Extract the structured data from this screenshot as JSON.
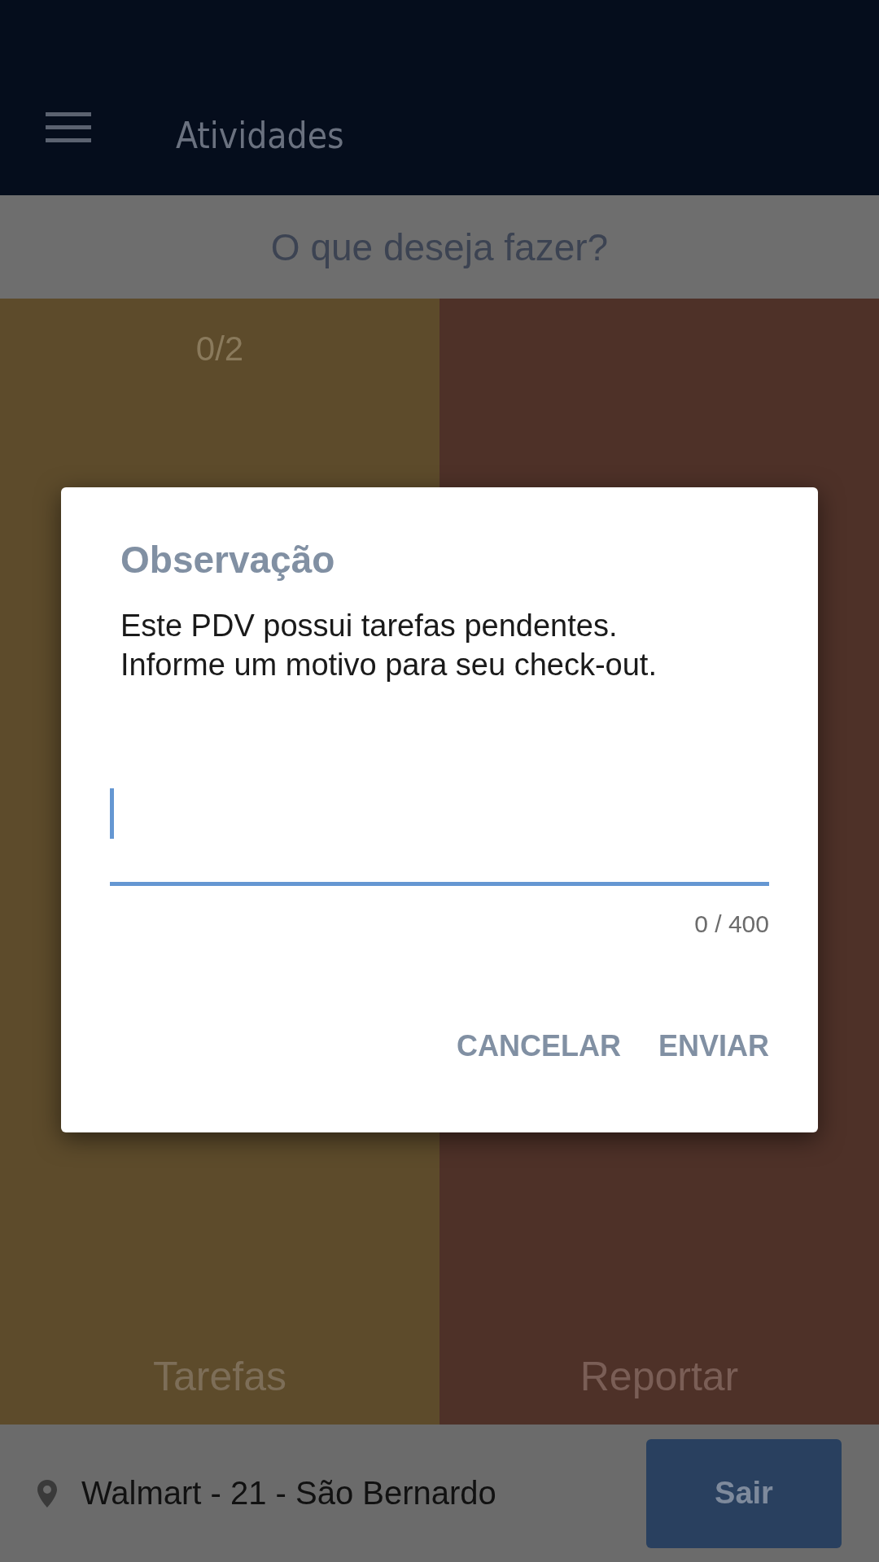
{
  "app_bar": {
    "title": "Atividades"
  },
  "header": {
    "title": "O que deseja fazer?"
  },
  "tiles": [
    {
      "label": "Tarefas",
      "count": "0/2",
      "color": "#5d4b2b"
    },
    {
      "label": "Reportar",
      "color": "#4e3128"
    }
  ],
  "footer": {
    "location": "Walmart - 21 - São Bernardo",
    "button": "Sair"
  },
  "dialog": {
    "title": "Observação",
    "message": [
      "Este PDV possui tarefas pendentes.",
      "Informe um motivo para seu check-out."
    ],
    "field": {
      "counter": "0 / 400"
    },
    "buttons": [
      "CANCELAR",
      "ENVIAR"
    ]
  }
}
